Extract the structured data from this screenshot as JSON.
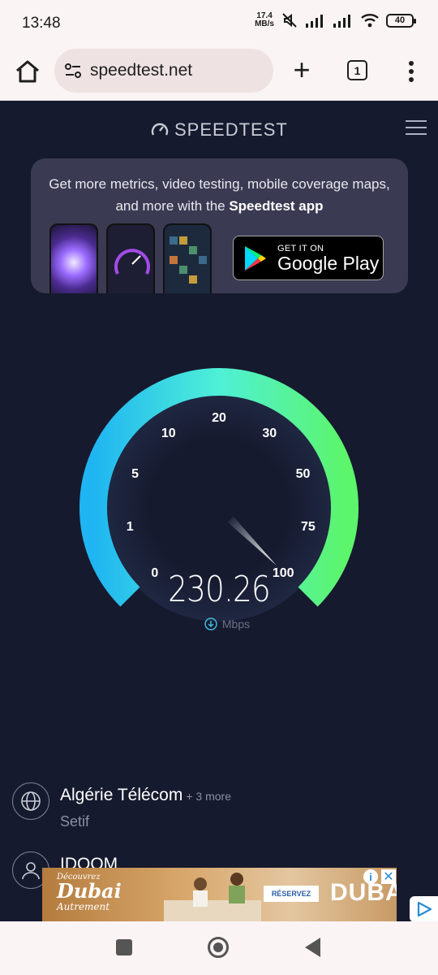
{
  "status_bar": {
    "time": "13:48",
    "net_speed_value": "17.4",
    "net_speed_unit": "MB/s",
    "battery": "40"
  },
  "browser": {
    "url": "speedtest.net",
    "tab_count": "1"
  },
  "speedtest": {
    "logo_text": "SPEEDTEST",
    "promo": {
      "text_before": "Get more metrics, video testing, mobile coverage maps, and more with the ",
      "text_bold": "Speedtest app",
      "badge_small": "GET IT ON",
      "badge_big": "Google Play"
    },
    "gauge": {
      "tick_labels": [
        "0",
        "1",
        "5",
        "10",
        "20",
        "30",
        "50",
        "75",
        "100"
      ],
      "needle_label": "100",
      "speed_value": "230.26",
      "unit": "Mbps",
      "gradient_start": "#1fb5f2",
      "gradient_mid": "#4ff0d7",
      "gradient_end": "#5cf56b"
    },
    "isp": {
      "name": "Algérie Télécom",
      "more": "+ 3 more",
      "location": "Setif"
    },
    "server": {
      "name": "IDOOM"
    }
  },
  "ad": {
    "tagline_top": "Découvrez",
    "brand_script": "Dubai",
    "tagline_bottom": "Autrement",
    "button": "RÉSERVEZ",
    "brand_logo": "DUBAI",
    "info": "i",
    "close": "✕"
  }
}
